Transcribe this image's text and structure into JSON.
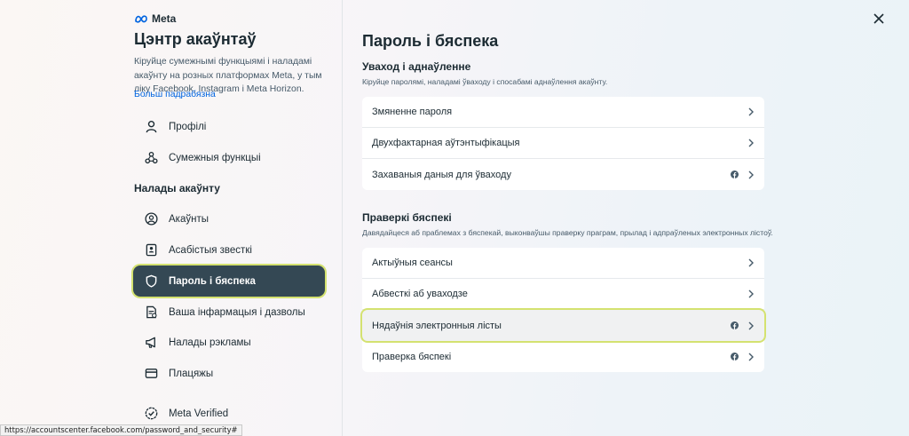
{
  "brand": {
    "logo_text": "Meta"
  },
  "sidebar": {
    "title": "Цэнтр акаўнтаў",
    "description": "Кіруйце сумежнымі функцыямі і наладамі акаўнту на розных платформах Meta, у тым ліку Facebook, Instagram і Meta Horizon.",
    "learn_more": "Больш падрабязна",
    "top_items": [
      {
        "label": "Профілі",
        "icon": "profile-icon"
      },
      {
        "label": "Сумежныя функцыі",
        "icon": "connected-features-icon"
      }
    ],
    "section_label": "Налады акаўнту",
    "settings_items": [
      {
        "label": "Акаўнты",
        "icon": "account-icon"
      },
      {
        "label": "Асабістыя звесткі",
        "icon": "personal-details-icon"
      },
      {
        "label": "Пароль і бяспека",
        "icon": "shield-icon",
        "active": true
      },
      {
        "label": "Ваша інфармацыя і дазволы",
        "icon": "info-permissions-icon"
      },
      {
        "label": "Налады рэкламы",
        "icon": "megaphone-icon"
      },
      {
        "label": "Плацяжы",
        "icon": "card-icon"
      },
      {
        "label": "Meta Verified",
        "icon": "verified-icon"
      }
    ]
  },
  "main": {
    "title": "Пароль і бяспека",
    "login_group": {
      "title": "Уваход і аднаўленне",
      "description": "Кіруйце паролямі, наладамі ўваходу і спосабамі аднаўлення акаўнту.",
      "rows": [
        {
          "label": "Змяненне пароля",
          "facebook": false
        },
        {
          "label": "Двухфактарная аўтэнтыфікацыя",
          "facebook": false
        },
        {
          "label": "Захаваныя даныя для ўваходу",
          "facebook": true
        }
      ]
    },
    "security_group": {
      "title": "Праверкі бяспекі",
      "description": "Давядайцеся аб праблемах з бяспекай, выконваўшы праверку праграм, прылад і адпраўленых электронных лістоў.",
      "rows": [
        {
          "label": "Актыўныя сеансы",
          "facebook": false
        },
        {
          "label": "Абвесткі аб уваходзе",
          "facebook": false
        },
        {
          "label": "Нядаўнія электронныя лісты",
          "facebook": true,
          "hovered": true
        },
        {
          "label": "Праверка бяспекі",
          "facebook": true
        }
      ]
    }
  },
  "status_bar": {
    "url": "https://accountscenter.facebook.com/password_and_security#"
  },
  "colors": {
    "active_bg": "#344854",
    "focus_ring": "#d4e270",
    "link": "#0064e0"
  }
}
